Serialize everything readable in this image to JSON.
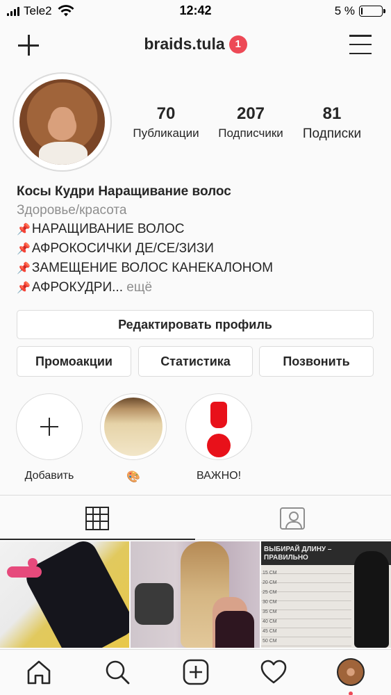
{
  "status_bar": {
    "carrier": "Tele2",
    "time": "12:42",
    "battery": "5 %",
    "battery_level": 0.05
  },
  "header": {
    "username": "braids.tula",
    "notification_count": "1"
  },
  "profile": {
    "stats": [
      {
        "value": "70",
        "label": "Публикации"
      },
      {
        "value": "207",
        "label": "Подписчики"
      },
      {
        "value": "81",
        "label": "Подписки"
      }
    ],
    "name": "Косы Кудри Наращивание волос",
    "category": "Здоровье/красота",
    "bio_lines": [
      "НАРАЩИВАНИЕ ВОЛОС",
      "АФРОКОСИЧКИ ДЕ/СЕ/ЗИЗИ",
      "ЗАМЕЩЕНИЕ ВОЛОС КАНЕКАЛОНОМ",
      "АФРОКУДРИ..."
    ],
    "more_label": "ещё",
    "pin_glyph": "📌"
  },
  "buttons": {
    "edit_profile": "Редактировать профиль",
    "promotions": "Промоакции",
    "insights": "Статистика",
    "call": "Позвонить"
  },
  "highlights": [
    {
      "label": "Добавить",
      "icon": "plus-icon"
    },
    {
      "label": "🎨",
      "icon": "hair-photo"
    },
    {
      "label": "ВАЖНО!",
      "icon": "exclamation-icon"
    }
  ],
  "tabs": [
    {
      "name": "grid",
      "icon": "grid-icon",
      "active": true
    },
    {
      "name": "tagged",
      "icon": "tagged-icon",
      "active": false
    }
  ],
  "posts": [
    {
      "description": "black curly hair extensions"
    },
    {
      "description": "long blond hair salon"
    },
    {
      "description": "hair length chart",
      "banner": "ВЫБИРАЙ ДЛИНУ –\nПРАВИЛЬНО",
      "ruler_labels": [
        "15 СМ",
        "20 СМ",
        "25 СМ",
        "30 СМ",
        "35 СМ",
        "40 СМ",
        "45 СМ",
        "50 СМ"
      ]
    }
  ],
  "bottom_nav": [
    {
      "icon": "home-icon"
    },
    {
      "icon": "search-icon"
    },
    {
      "icon": "add-post-icon"
    },
    {
      "icon": "heart-icon"
    },
    {
      "icon": "profile-avatar"
    }
  ],
  "colors": {
    "badge": "#ed4956",
    "text": "#262626",
    "muted": "#8e8e8e",
    "border": "#dbdbdb",
    "important_red": "#e8111a"
  }
}
